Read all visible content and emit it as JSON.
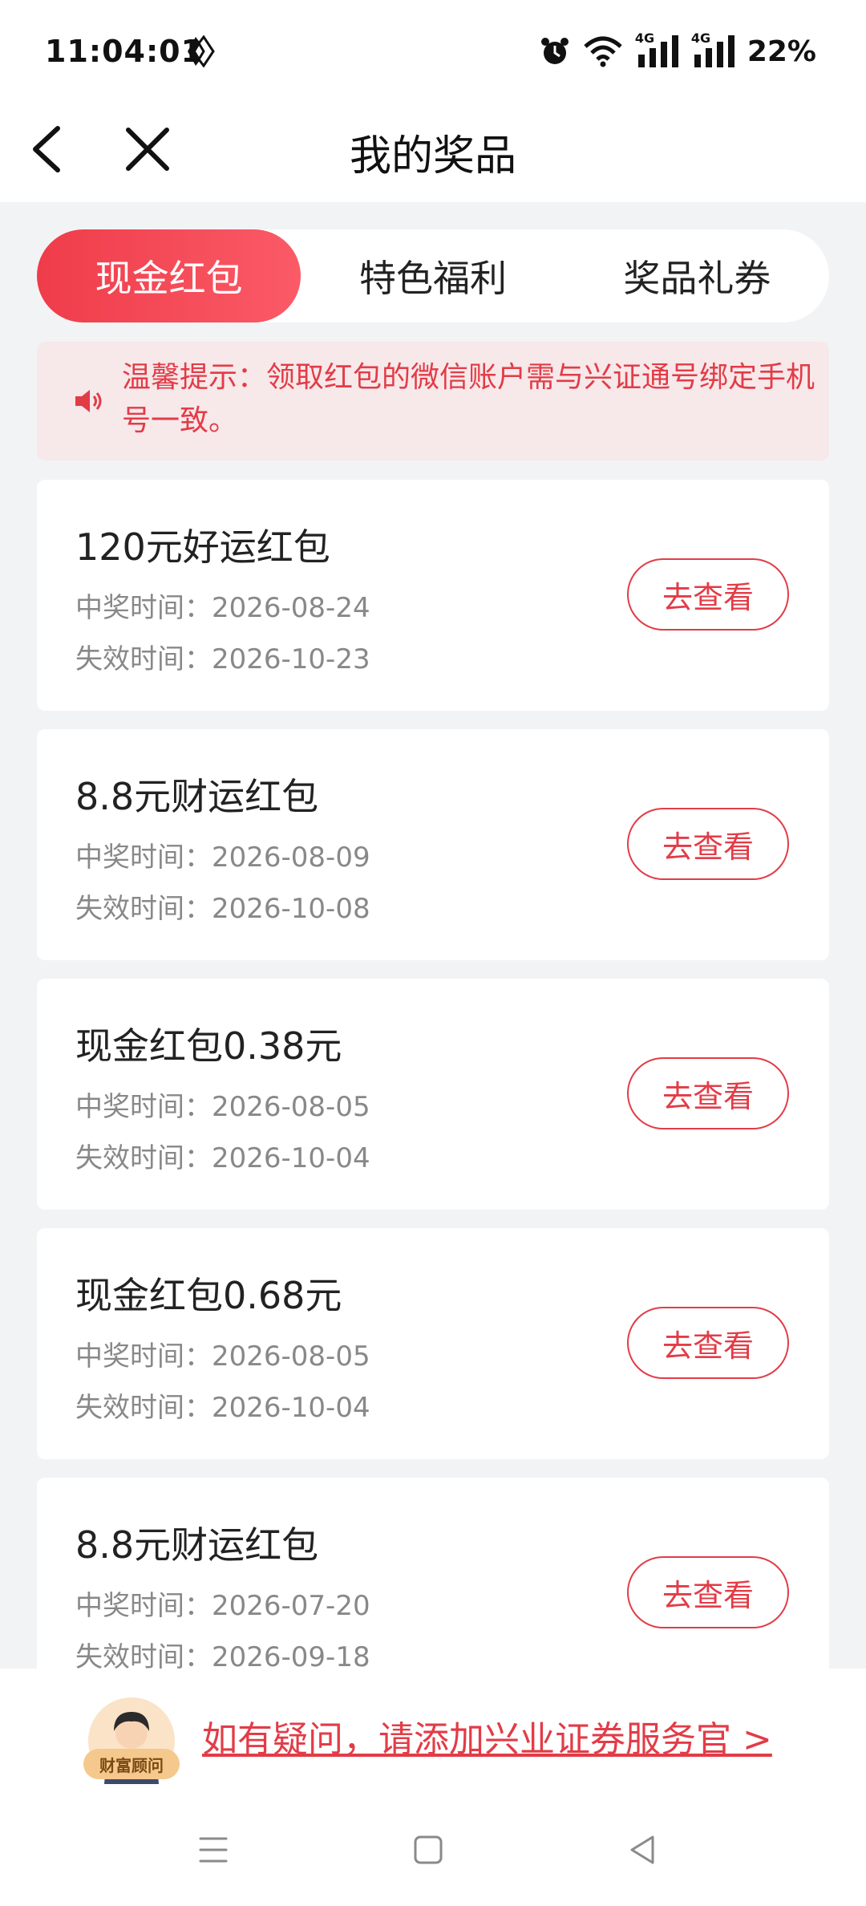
{
  "status_bar": {
    "time": "11:04:01",
    "battery": "22%",
    "network_label": "4G"
  },
  "nav": {
    "title": "我的奖品"
  },
  "tabs": [
    {
      "label": "现金红包",
      "active": true
    },
    {
      "label": "特色福利",
      "active": false
    },
    {
      "label": "奖品礼券",
      "active": false
    }
  ],
  "tip": {
    "text": "温馨提示：领取红包的微信账户需与兴证通号绑定手机号一致。"
  },
  "prizes": [
    {
      "title": "120元好运红包",
      "win_time": "中奖时间：2026-08-24",
      "expire_time": "失效时间：2026-10-23",
      "button": "去查看"
    },
    {
      "title": "8.8元财运红包",
      "win_time": "中奖时间：2026-08-09",
      "expire_time": "失效时间：2026-10-08",
      "button": "去查看"
    },
    {
      "title": "现金红包0.38元",
      "win_time": "中奖时间：2026-08-05",
      "expire_time": "失效时间：2026-10-04",
      "button": "去查看"
    },
    {
      "title": "现金红包0.68元",
      "win_time": "中奖时间：2026-08-05",
      "expire_time": "失效时间：2026-10-04",
      "button": "去查看"
    },
    {
      "title": "8.8元财运红包",
      "win_time": "中奖时间：2026-07-20",
      "expire_time": "失效时间：2026-09-18",
      "button": "去查看"
    }
  ],
  "footer": {
    "advisor_badge": "财富顾问",
    "link_text": "如有疑问，请添加兴业证券服务官 >"
  },
  "colors": {
    "accent": "#e23c47",
    "tab_gradient_start": "#ef3c4a",
    "tab_gradient_end": "#fb5a67",
    "tip_background": "#f7e8ea",
    "page_background": "#f2f3f5"
  }
}
